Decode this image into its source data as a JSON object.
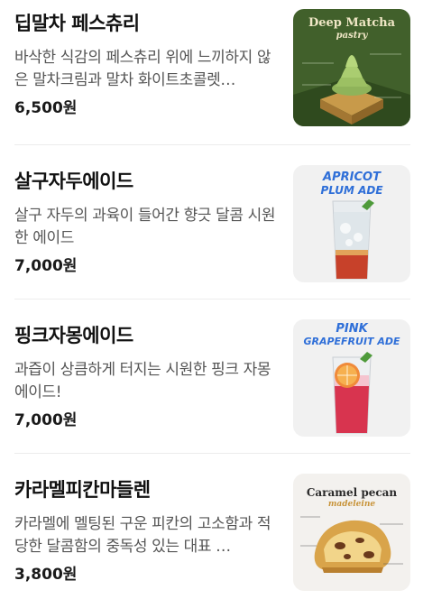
{
  "menu": [
    {
      "name": "딥말차 페스츄리",
      "description": "바삭한 식감의 페스츄리 위에 느끼하지 않은 말차크림과 말차 화이트초콜렛…",
      "price": "6,500원",
      "image": {
        "title": "Deep Matcha",
        "subtitle": "pastry",
        "bg": "#3f5c2a"
      }
    },
    {
      "name": "살구자두에이드",
      "description": "살구 자두의 과육이 들어간 향긋 달콤 시원한 에이드",
      "price": "7,000원",
      "image": {
        "title": "APRICOT",
        "subtitle": "PLUM ADE",
        "bg": "#f2f2f2"
      }
    },
    {
      "name": "핑크자몽에이드",
      "description": "과즙이 상큼하게 터지는 시원한 핑크 자몽에이드!",
      "price": "7,000원",
      "image": {
        "title": "PINK",
        "subtitle": "GRAPEFRUIT ADE",
        "bg": "#f2f2f2"
      }
    },
    {
      "name": "카라멜피칸마들렌",
      "description": "카라멜에 멜팅된 구운 피칸의 고소함과 적당한 달콤함의 중독성 있는 대표 …",
      "price": "3,800원",
      "image": {
        "title": "Caramel pecan",
        "subtitle": "madeleine",
        "bg": "#f3f1ee"
      }
    }
  ],
  "colors": {
    "accent_blue": "#2f6fd8",
    "matcha": "#6f9a3c"
  }
}
